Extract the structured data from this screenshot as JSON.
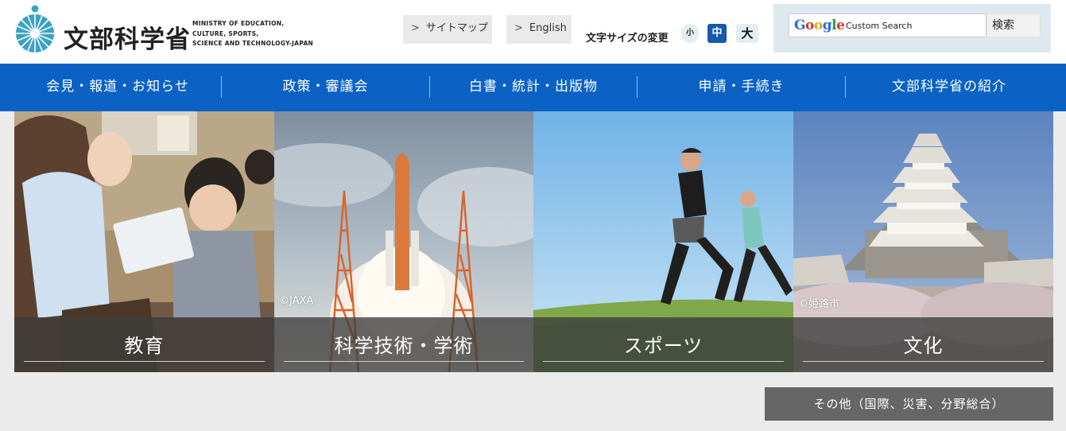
{
  "header": {
    "logo_jp": "文部科学省",
    "logo_en": [
      "MINISTRY OF EDUCATION,",
      "CULTURE, SPORTS,",
      "SCIENCE AND TECHNOLOGY-JAPAN"
    ],
    "sitemap_label": "サイトマップ",
    "english_label": "English",
    "font_size_label": "文字サイズの変更",
    "font_small": "小",
    "font_medium": "中",
    "font_large": "大",
    "search": {
      "google_label": "Google",
      "custom_search_label": "Custom Search",
      "button_label": "検索"
    }
  },
  "nav": {
    "items": [
      {
        "label": "会見・報道・お知らせ"
      },
      {
        "label": "政策・審議会"
      },
      {
        "label": "白書・統計・出版物"
      },
      {
        "label": "申請・手続き"
      },
      {
        "label": "文部科学省の紹介"
      }
    ]
  },
  "tiles": [
    {
      "label": "教育",
      "credit": ""
    },
    {
      "label": "科学技術・学術",
      "credit": "©JAXA"
    },
    {
      "label": "スポーツ",
      "credit": ""
    },
    {
      "label": "文化",
      "credit": "©姫路市"
    }
  ],
  "other_button": {
    "label": "その他（国際、災害、分野総合）"
  },
  "colors": {
    "nav_blue": "#0b62c4",
    "font_mid_active": "#1559b0",
    "logo_teal": "#3aa3c4",
    "caption_bg": "#3c3c3c",
    "other_button": "#666666"
  },
  "icons": [
    "logo-mark-icon",
    "chevron-right-icon",
    "google-logo"
  ]
}
